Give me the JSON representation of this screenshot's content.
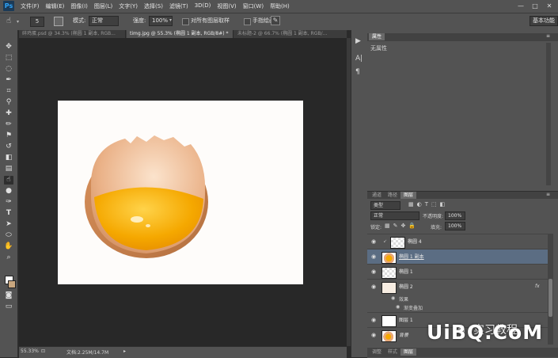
{
  "app": {
    "logo": "Ps"
  },
  "menu": [
    "文件(F)",
    "编辑(E)",
    "图像(I)",
    "图层(L)",
    "文字(Y)",
    "选择(S)",
    "滤镜(T)",
    "3D(D)",
    "视图(V)",
    "窗口(W)",
    "帮助(H)"
  ],
  "window_controls": {
    "minimize": "—",
    "maximize": "□",
    "close": "✕"
  },
  "options": {
    "brush_size": "5",
    "mode_label": "模式:",
    "mode_value": "正常",
    "strength_label": "强度:",
    "strength_value": "100%",
    "sample_all_label": "对所有图层取样",
    "finger_paint_label": "手指绘画",
    "workspace": "基本功能"
  },
  "tabs": [
    {
      "label": "碎鸡蛋.psd @ 34.3% (椭圆 1 副本, RGB...",
      "active": false
    },
    {
      "label": "timg.jpg @ 55.3% (椭圆 1 副本, RGB/8#) *",
      "active": true
    },
    {
      "label": "未标题-2 @ 66.7% (椭圆 1 副本, RGB/...",
      "active": false
    }
  ],
  "status": {
    "zoom": "55.33%",
    "doc": "文档:2.25M/14.7M"
  },
  "properties": {
    "tab": "属性",
    "content": "无属性"
  },
  "layers_panel": {
    "tabs": [
      {
        "label": "通道",
        "active": false
      },
      {
        "label": "路径",
        "active": false
      },
      {
        "label": "图层",
        "active": true
      }
    ],
    "filter_kind": "类型",
    "blend_mode": "正常",
    "opacity_label": "不透明度:",
    "opacity_value": "100%",
    "lock_label": "锁定:",
    "fill_label": "填充:",
    "fill_value": "100%",
    "layers": [
      {
        "name": "椭圆 4"
      },
      {
        "name": "椭圆 1 副本"
      },
      {
        "name": "椭圆 1"
      },
      {
        "name": "椭圆 2",
        "fx": "fx"
      },
      {
        "name": "效果"
      },
      {
        "name": "渐变叠加"
      },
      {
        "name": "图层 1"
      },
      {
        "name": "背景"
      }
    ]
  },
  "bottom_tabs": [
    "调整",
    "样式",
    "图层"
  ],
  "watermark": {
    "brand": "UiBQ.CoM",
    "overlay": "实习教程"
  },
  "colors": {
    "accent": "#2fa3f7",
    "selected_row": "#5b6d83",
    "yolk": "#f5a800",
    "shell": "#e8a877"
  }
}
